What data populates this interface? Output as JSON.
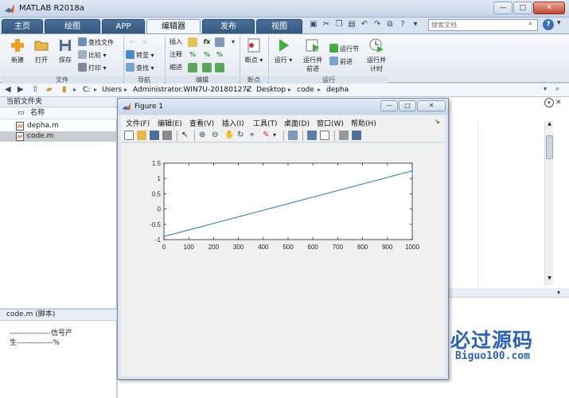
{
  "app": {
    "title": "MATLAB R2018a"
  },
  "window_controls": {
    "minimize": "—",
    "maximize": "□",
    "close": "✕"
  },
  "tabs": [
    {
      "label": "主页"
    },
    {
      "label": "绘图"
    },
    {
      "label": "APP"
    },
    {
      "label": "编辑器"
    },
    {
      "label": "发布"
    },
    {
      "label": "视图"
    }
  ],
  "active_tab": "编辑器",
  "search": {
    "placeholder": "搜索文档"
  },
  "ribbon": {
    "file_group": {
      "label": "文件",
      "new": "新建",
      "open": "打开",
      "save": "保存",
      "find_files": "查找文件",
      "compare": "比较",
      "print": "打印"
    },
    "navigate_group": {
      "label": "导航",
      "goto": "转至",
      "find": "查找"
    },
    "edit_group": {
      "label": "编辑",
      "insert": "插入",
      "comment": "注释",
      "indent": "缩进"
    },
    "breakpoints_group": {
      "label": "断点",
      "breakpoints": "断点"
    },
    "run_group": {
      "label": "运行",
      "run": "运行",
      "run_advance_1": "运行并",
      "run_advance_2": "前进",
      "run_section": "运行节",
      "advance": "前进",
      "run_time_1": "运行并",
      "run_time_2": "计时"
    }
  },
  "address": {
    "segments": [
      "C:",
      "Users",
      "Administrator.WIN7U-20180127Z",
      "Desktop",
      "code",
      "depha"
    ]
  },
  "current_folder": {
    "title": "当前文件夹",
    "column_name": "名称",
    "files": [
      {
        "name": "depha.m",
        "selected": false
      },
      {
        "name": "code.m",
        "selected": true
      }
    ]
  },
  "details": {
    "title": "code.m  (脚本)",
    "lines": [
      "----------------信号产",
      "生--------------%"
    ]
  },
  "figure": {
    "title": "Figure 1",
    "menus": [
      "文件(F)",
      "编辑(E)",
      "查看(V)",
      "插入(I)",
      "工具(T)",
      "桌面(D)",
      "窗口(W)",
      "帮助(H)"
    ]
  },
  "chart_data": {
    "type": "line",
    "title": "",
    "xlabel": "",
    "ylabel": "",
    "xlim": [
      0,
      1000
    ],
    "ylim": [
      -1,
      1.5
    ],
    "xticks": [
      0,
      100,
      200,
      300,
      400,
      500,
      600,
      700,
      800,
      900,
      1000
    ],
    "yticks": [
      -1,
      -0.5,
      0,
      0.5,
      1,
      1.5
    ],
    "grid": false,
    "series": [
      {
        "color": "#1f77b4",
        "x": [
          0,
          1000,
          1000
        ],
        "y": [
          -0.9,
          1.25,
          1.1
        ]
      }
    ]
  },
  "watermark": {
    "title": "必过源码",
    "url": "Biguo100.com"
  },
  "colors": {
    "tab_active_bg": "#f3f6fa",
    "tab_bg": "#35587f",
    "watermark": "#2a62b9",
    "plot_line": "#1f77b4"
  }
}
